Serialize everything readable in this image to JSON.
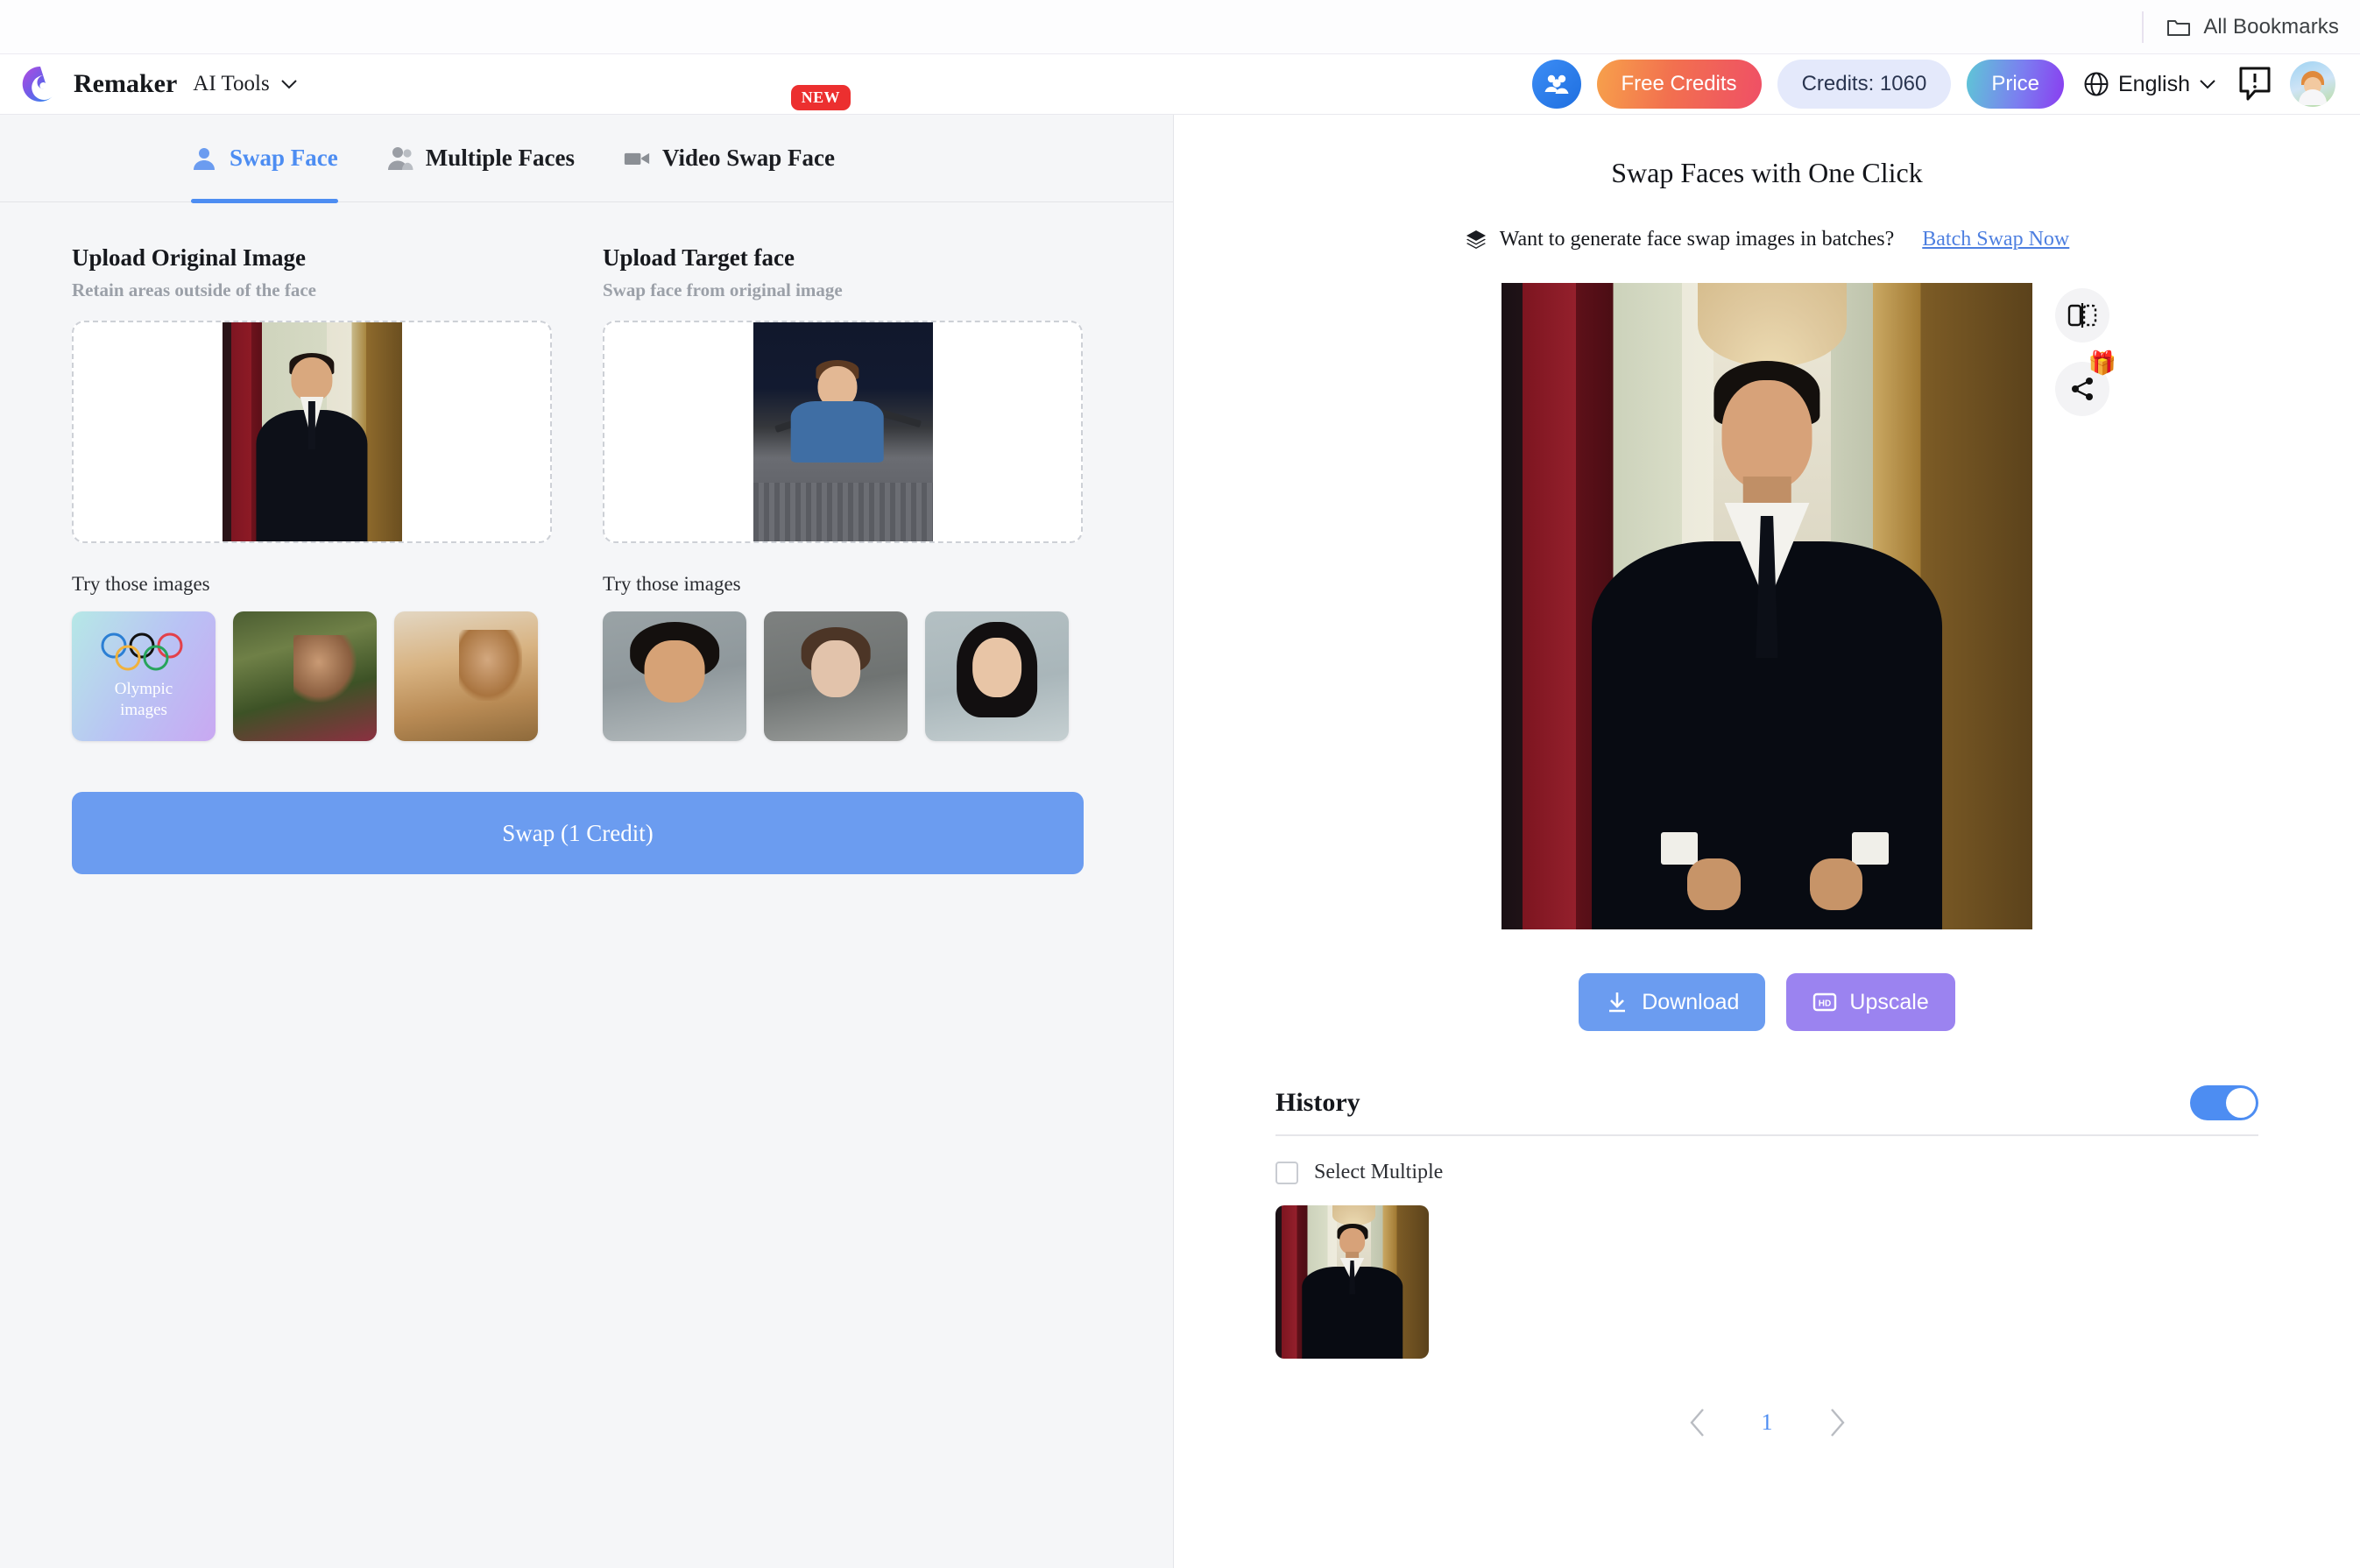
{
  "browser": {
    "bookmarks_label": "All Bookmarks",
    "folder_icon": "folder-icon"
  },
  "header": {
    "brand_name": "Remaker",
    "ai_tools_label": "AI Tools",
    "chevron_icon": "chevron-down-icon",
    "affiliate_icon": "users-group-icon",
    "free_credits_label": "Free Credits",
    "credits_label": "Credits: 1060",
    "price_label": "Price",
    "language_label": "English",
    "globe_icon": "globe-icon",
    "feedback_icon": "feedback-icon",
    "avatar_icon": "user-avatar"
  },
  "tabs": [
    {
      "label": "Swap Face",
      "icon": "single-person-icon",
      "active": true,
      "badge": ""
    },
    {
      "label": "Multiple Faces",
      "icon": "multiple-people-icon",
      "active": false,
      "badge": ""
    },
    {
      "label": "Video Swap Face",
      "icon": "video-camera-icon",
      "active": false,
      "badge": "NEW"
    }
  ],
  "uploads": {
    "original": {
      "title": "Upload Original Image",
      "subtitle": "Retain areas outside of the face",
      "samples_label": "Try those images"
    },
    "target": {
      "title": "Upload Target face",
      "subtitle": "Swap face from original image",
      "samples_label": "Try those images"
    }
  },
  "samples": {
    "original": [
      {
        "name": "olympic-images",
        "line1": "Olympic",
        "line2": "images"
      },
      {
        "name": "woman-green-background",
        "line1": "",
        "line2": ""
      },
      {
        "name": "woman-sunset-background",
        "line1": "",
        "line2": ""
      }
    ],
    "target": [
      {
        "name": "man-curly-hair",
        "line1": "",
        "line2": ""
      },
      {
        "name": "woman-grey-background",
        "line1": "",
        "line2": ""
      },
      {
        "name": "woman-dark-hair",
        "line1": "",
        "line2": ""
      }
    ]
  },
  "swap_button": {
    "label": "Swap (1 Credit)"
  },
  "result": {
    "title": "Swap Faces with One Click",
    "batch_question": "Want to generate face swap images in batches?",
    "batch_link": "Batch Swap Now",
    "stack_icon": "layers-icon",
    "compare_icon": "compare-split-icon",
    "share_icon": "share-icon",
    "gift_icon": "gift-icon",
    "download_label": "Download",
    "download_icon": "download-icon",
    "upscale_label": "Upscale",
    "upscale_icon": "hd-icon"
  },
  "history": {
    "title": "History",
    "toggle_on": true,
    "select_multiple_label": "Select Multiple",
    "items": [
      {
        "name": "history-result-1"
      }
    ],
    "pagination": {
      "prev_icon": "chevron-left-icon",
      "current_page": "1",
      "next_icon": "chevron-right-icon"
    }
  },
  "colors": {
    "accent_blue": "#4d8df2",
    "button_blue": "#6b9cf0",
    "upscale_purple": "#9b83f0",
    "badge_red": "#ec2f2f",
    "left_bg": "#f5f6f8"
  }
}
